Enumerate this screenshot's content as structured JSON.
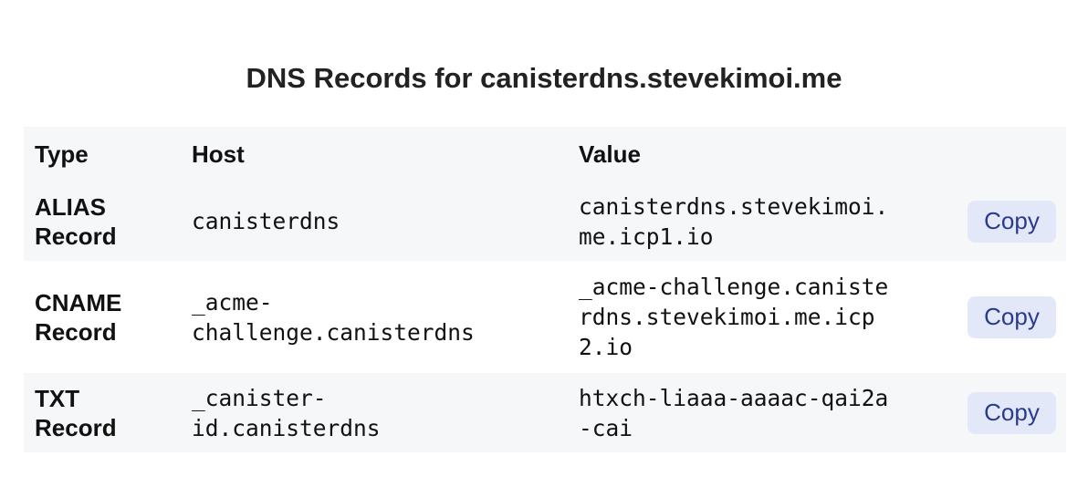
{
  "title": "DNS Records for canisterdns.stevekimoi.me",
  "columns": {
    "type": "Type",
    "host": "Host",
    "value": "Value"
  },
  "records": [
    {
      "type_line1": "ALIAS",
      "type_line2": "Record",
      "host": "canisterdns",
      "value": "canisterdns.stevekimoi.\nme.icp1.io",
      "copy_label": "Copy"
    },
    {
      "type_line1": "CNAME",
      "type_line2": "Record",
      "host": "_acme-\nchallenge.canisterdns",
      "value": "_acme-challenge.caniste\nrdns.stevekimoi.me.icp\n2.io",
      "copy_label": "Copy"
    },
    {
      "type_line1": "TXT",
      "type_line2": "Record",
      "host": "_canister-\nid.canisterdns",
      "value": "htxch-liaaa-aaaac-qai2a\n-cai",
      "copy_label": "Copy"
    }
  ],
  "colors": {
    "row_alt": "#f6f7f9",
    "button_bg": "#e3e8f8",
    "button_text": "#2a3a8c"
  }
}
